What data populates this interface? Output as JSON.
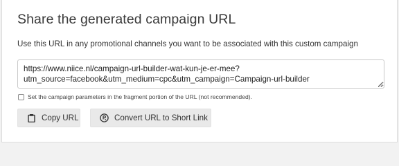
{
  "panel": {
    "title": "Share the generated campaign URL",
    "description": "Use this URL in any promotional channels you want to be associated with this custom campaign"
  },
  "url_field": {
    "line1": "https://www.niice.nl/campaign-url-builder-wat-kun-je-er-mee?",
    "line2": "utm_source=facebook&utm_medium=cpc&utm_campaign=Campaign-url-builder"
  },
  "fragment_option": {
    "label": "Set the campaign parameters in the fragment portion of the URL (not recommended).",
    "checked": false
  },
  "buttons": {
    "copy": {
      "label": "Copy URL",
      "icon": "clipboard-icon"
    },
    "shorten": {
      "label": "Convert URL to Short Link",
      "icon": "link-icon"
    }
  }
}
